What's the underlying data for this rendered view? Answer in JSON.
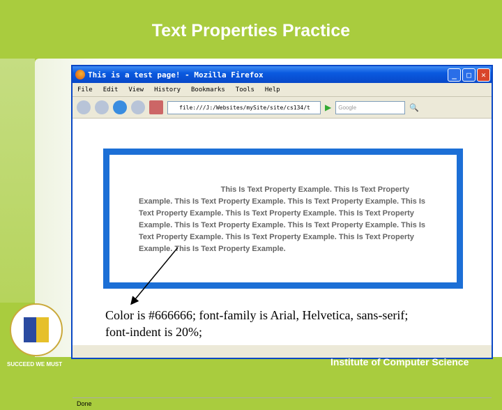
{
  "slide": {
    "title": "Text Properties Practice",
    "footer": "Institute of Computer Science",
    "motto": "SUCCEED WE MUST"
  },
  "browser": {
    "title": "This is a test page! - Mozilla Firefox",
    "menu": [
      "File",
      "Edit",
      "View",
      "History",
      "Bookmarks",
      "Tools",
      "Help"
    ],
    "url": "file:///J:/Websites/mySite/site/cs134/t",
    "search_placeholder": "Google",
    "status": "Done"
  },
  "page": {
    "paragraph": "This Is Text Property Example. This Is Text Property Example. This Is Text Property Example. This Is Text Property Example. This Is Text Property Example. This Is Text Property Example. This Is Text Property Example. This Is Text Property Example. This Is Text Property Example. This Is Text Property Example. This Is Text Property Example. This Is Text Property Example. This Is Text Property Example.",
    "caption_line1": "Color is #666666; font-family is Arial, Helvetica, sans-serif;",
    "caption_line2": "font-indent is 20%;"
  },
  "colors": {
    "slide_green": "#a9cc3e",
    "box_blue": "#1c6fd6",
    "text_gray": "#666666"
  }
}
